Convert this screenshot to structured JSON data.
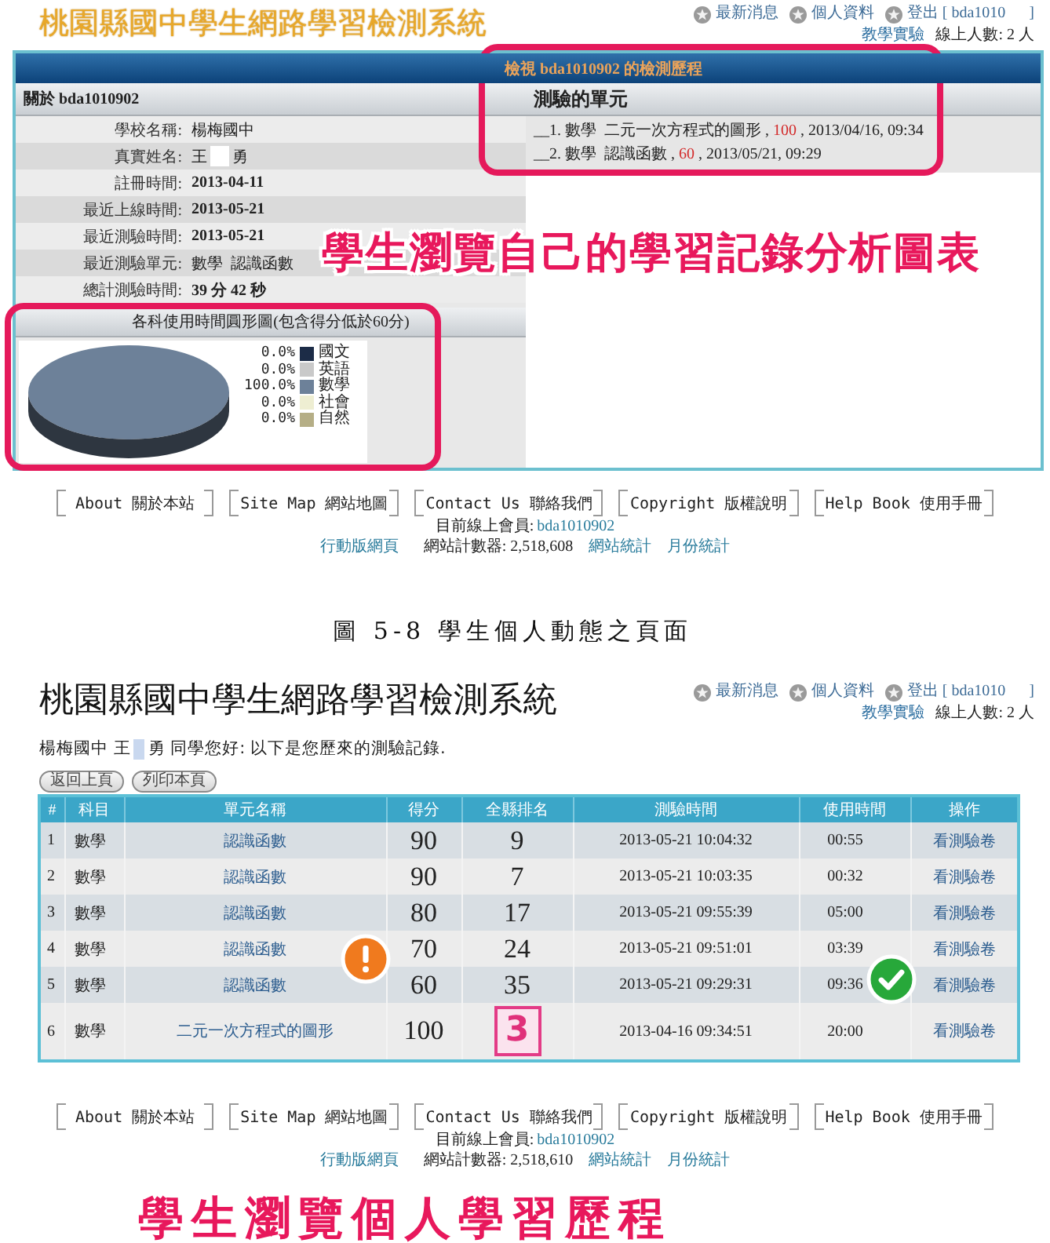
{
  "top_screen": {
    "header": {
      "title": "桃園縣國中學生網路學習檢測系統",
      "nav": [
        "最新消息",
        "個人資料",
        "登出 [ bda1010      ]"
      ],
      "link": "教學實驗",
      "online": "線上人數: 2 人"
    },
    "panel_title": "檢視 bda1010902 的檢測歷程",
    "profile": {
      "heading": "關於 bda1010902",
      "rows": [
        {
          "kind": "plain",
          "label": "學校名稱:",
          "value": "楊梅國中",
          "bold": false
        },
        {
          "kind": "redacted",
          "label": "真實姓名:",
          "value": "王",
          "value_after": "勇",
          "bold": false
        },
        {
          "kind": "plain",
          "label": "註冊時間:",
          "value": "2013-04-11",
          "bold": true
        },
        {
          "kind": "plain",
          "label": "最近上線時間:",
          "value": "2013-05-21",
          "bold": true
        },
        {
          "kind": "plain",
          "label": "最近測驗時間:",
          "value": "2013-05-21",
          "bold": true
        },
        {
          "kind": "plain",
          "label": "最近測驗單元:",
          "value": "數學  認識函數",
          "bold": false
        },
        {
          "kind": "plain",
          "label": "總計測驗時間:",
          "value": "39 分 42 秒",
          "bold": true
        }
      ]
    },
    "pie": {
      "chart_data": {
        "type": "pie",
        "title": "各科使用時間圓形圖(包含得分低於60分)",
        "categories": [
          "國文",
          "英語",
          "數學",
          "社會",
          "自然"
        ],
        "values": [
          0,
          0,
          100,
          0,
          0
        ]
      },
      "legend": [
        {
          "reading": "0.0%",
          "color": "#1c2c47"
        },
        {
          "reading": "0.0%",
          "color": "#c9c9c9"
        },
        {
          "reading": "100.0%",
          "color": "#6d8199"
        },
        {
          "reading": "0.0%",
          "color": "#eeeed2"
        },
        {
          "reading": "0.0%",
          "color": "#b5ae86"
        }
      ]
    },
    "units": {
      "heading": "測驗的單元",
      "items": [
        {
          "before": "__1. 數學  二元一次方程式的圖形 , ",
          "score": "100",
          "after": " , 2013/04/16, 09:34"
        },
        {
          "before": "__2. 數學  認識函數 , ",
          "score": "60",
          "after": " , 2013/05/21, 09:29"
        }
      ]
    },
    "annotation": "學生瀏覽自己的學習記錄分析圖表"
  },
  "top_footer": {
    "links": [
      "About 關於本站",
      "Site Map 網站地圖",
      "Contact Us 聯絡我們",
      "Copyright 版權說明",
      "Help Book 使用手冊"
    ],
    "member_label": "目前線上會員:",
    "member": "bda1010902",
    "mobile": "行動版網頁",
    "counter": "網站計數器: 2,518,608",
    "stats": "網站統計",
    "monthly": "月份統計"
  },
  "caption": "圖 5-8 學生個人動態之頁面",
  "second_screen": {
    "header": {
      "title": "桃園縣國中學生網路學習檢測系統",
      "nav": [
        "最新消息",
        "個人資料",
        "登出 [ bda1010      ]"
      ],
      "link": "教學實驗",
      "online": "線上人數: 2 人"
    },
    "greeting": {
      "before": "楊梅國中 王",
      "after": "勇 同學您好: 以下是您歷來的測驗記錄."
    },
    "buttons": [
      "返回上頁",
      "列印本頁"
    ],
    "table": {
      "columns": [
        "#",
        "科目",
        "單元名稱",
        "得分",
        "全縣排名",
        "測驗時間",
        "使用時間",
        "操作"
      ],
      "rows": [
        {
          "no": "1",
          "subject": "數學",
          "unit": "認識函數",
          "score": "90",
          "rank": "9",
          "time": "2013-05-21 10:04:32",
          "duration": "00:55",
          "action": "看測驗卷",
          "rank_badge": false
        },
        {
          "no": "2",
          "subject": "數學",
          "unit": "認識函數",
          "score": "90",
          "rank": "7",
          "time": "2013-05-21 10:03:35",
          "duration": "00:32",
          "action": "看測驗卷",
          "rank_badge": false
        },
        {
          "no": "3",
          "subject": "數學",
          "unit": "認識函數",
          "score": "80",
          "rank": "17",
          "time": "2013-05-21 09:55:39",
          "duration": "05:00",
          "action": "看測驗卷",
          "rank_badge": false
        },
        {
          "no": "4",
          "subject": "數學",
          "unit": "認識函數",
          "score": "70",
          "rank": "24",
          "time": "2013-05-21 09:51:01",
          "duration": "03:39",
          "action": "看測驗卷",
          "rank_badge": false
        },
        {
          "no": "5",
          "subject": "數學",
          "unit": "認識函數",
          "score": "60",
          "rank": "35",
          "time": "2013-05-21 09:29:31",
          "duration": "09:36",
          "action": "看測驗卷",
          "rank_badge": false
        },
        {
          "no": "6",
          "subject": "數學",
          "unit": "二元一次方程式的圖形",
          "score": "100",
          "rank": "3",
          "time": "2013-04-16 09:34:51",
          "duration": "20:00",
          "action": "看測驗卷",
          "rank_badge": true
        }
      ]
    }
  },
  "second_footer": {
    "links": [
      "About 關於本站",
      "Site Map 網站地圖",
      "Contact Us 聯絡我們",
      "Copyright 版權說明",
      "Help Book 使用手冊"
    ],
    "member_label": "目前線上會員:",
    "member": "bda1010902",
    "mobile": "行動版網頁",
    "counter": "網站計數器: 2,518,610",
    "stats": "網站統計",
    "monthly": "月份統計"
  },
  "bottom_annotation": "學生瀏覽個人學習歷程"
}
